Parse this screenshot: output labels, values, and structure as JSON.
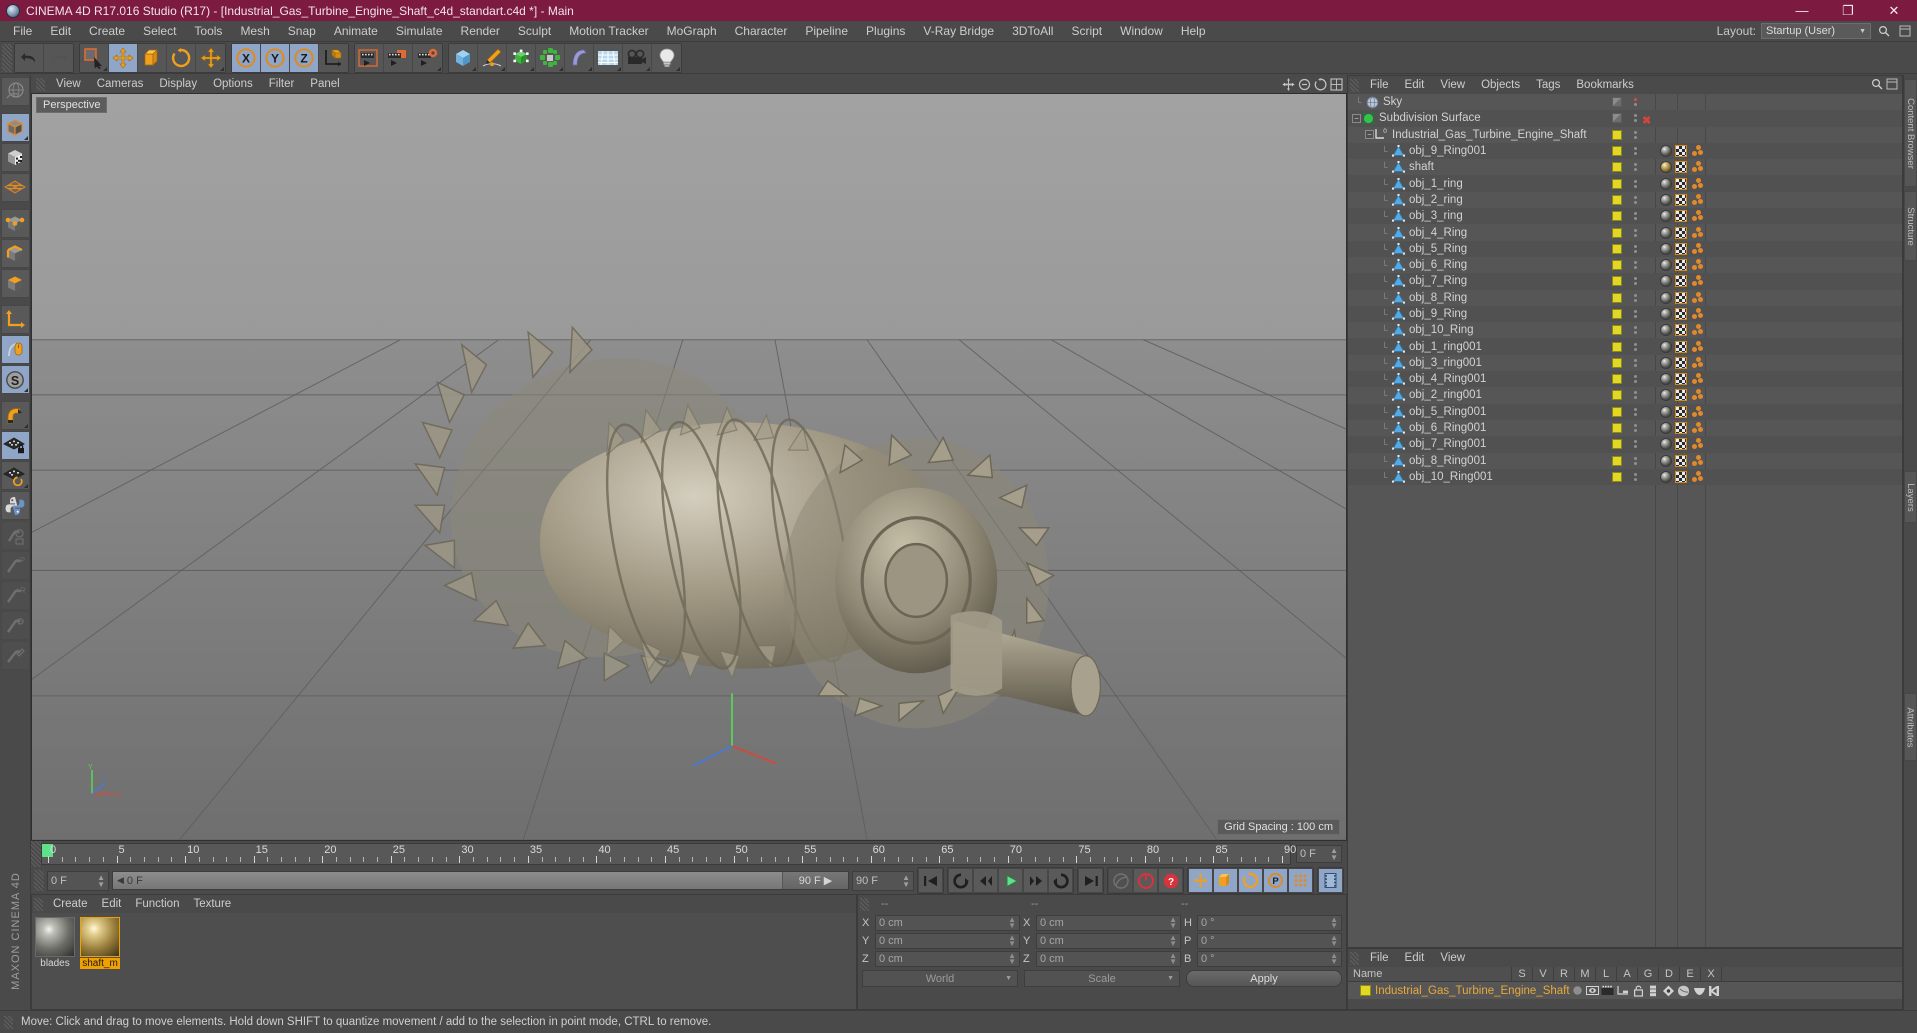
{
  "titlebar": {
    "title": "CINEMA 4D R17.016 Studio (R17) - [Industrial_Gas_Turbine_Engine_Shaft_c4d_standart.c4d *] - Main",
    "minimize": "—",
    "maximize": "❐",
    "close": "✕"
  },
  "menubar": {
    "items": [
      "File",
      "Edit",
      "Create",
      "Select",
      "Tools",
      "Mesh",
      "Snap",
      "Animate",
      "Simulate",
      "Render",
      "Sculpt",
      "Motion Tracker",
      "MoGraph",
      "Character",
      "Pipeline",
      "Plugins",
      "V-Ray Bridge",
      "3DToAll",
      "Script",
      "Window",
      "Help"
    ],
    "layout_label": "Layout:",
    "layout_value": "Startup (User)"
  },
  "viewport": {
    "menu": [
      "View",
      "Cameras",
      "Display",
      "Options",
      "Filter",
      "Panel"
    ],
    "persp_label": "Perspective",
    "grid_spacing": "Grid Spacing : 100 cm"
  },
  "timeline": {
    "ticks": [
      "0",
      "5",
      "10",
      "15",
      "20",
      "25",
      "30",
      "35",
      "40",
      "45",
      "50",
      "55",
      "60",
      "65",
      "70",
      "75",
      "80",
      "85",
      "90"
    ],
    "current_frame": "0 F",
    "start_frame": "0 F",
    "end_frame_track": "90 F",
    "end_frame": "90 F",
    "preview_end": "0 F"
  },
  "materials_panel": {
    "menu": [
      "Create",
      "Edit",
      "Function",
      "Texture"
    ],
    "items": [
      {
        "name": "blades",
        "selected": false,
        "kind": "grey"
      },
      {
        "name": "shaft_m",
        "selected": true,
        "kind": "gold"
      }
    ]
  },
  "coordinates": {
    "header_dashes": [
      "--",
      "--",
      "--"
    ],
    "rows": [
      {
        "pos_label": "X",
        "pos_value": "0 cm",
        "size_label": "X",
        "size_value": "0 cm",
        "rot_label": "H",
        "rot_value": "0 °"
      },
      {
        "pos_label": "Y",
        "pos_value": "0 cm",
        "size_label": "Y",
        "size_value": "0 cm",
        "rot_label": "P",
        "rot_value": "0 °"
      },
      {
        "pos_label": "Z",
        "pos_value": "0 cm",
        "size_label": "Z",
        "size_value": "0 cm",
        "rot_label": "B",
        "rot_value": "0 °"
      }
    ],
    "system": "World",
    "mode": "Scale",
    "apply": "Apply"
  },
  "object_manager": {
    "menu": [
      "File",
      "Edit",
      "View",
      "Objects",
      "Tags",
      "Bookmarks"
    ],
    "items": [
      {
        "label": "Sky",
        "depth": 1,
        "icon": "sky-icon",
        "expander": false,
        "swatch": "grey",
        "dots": "red",
        "tags": []
      },
      {
        "label": "Subdivision Surface",
        "depth": 1,
        "icon": "subdivision-icon",
        "expander": true,
        "swatch": "grey",
        "dots": "x",
        "tags": []
      },
      {
        "label": "Industrial_Gas_Turbine_Engine_Shaft",
        "depth": 2,
        "icon": "null-icon",
        "expander": true,
        "swatch": "yellow",
        "dots": "grey",
        "tags": [],
        "highlight": false
      },
      {
        "label": "obj_9_Ring001",
        "depth": 3,
        "icon": "polygon-icon",
        "swatch": "yellow",
        "dots": "grey",
        "tags": [
          "mat",
          "check",
          "sel"
        ]
      },
      {
        "label": "shaft",
        "depth": 3,
        "icon": "polygon-icon",
        "swatch": "yellow",
        "dots": "grey",
        "tags": [
          "mat-gold",
          "check",
          "sel"
        ]
      },
      {
        "label": "obj_1_ring",
        "depth": 3,
        "icon": "polygon-icon",
        "swatch": "yellow",
        "dots": "grey",
        "tags": [
          "mat",
          "check",
          "sel"
        ]
      },
      {
        "label": "obj_2_ring",
        "depth": 3,
        "icon": "polygon-icon",
        "swatch": "yellow",
        "dots": "grey",
        "tags": [
          "mat",
          "check",
          "sel"
        ]
      },
      {
        "label": "obj_3_ring",
        "depth": 3,
        "icon": "polygon-icon",
        "swatch": "yellow",
        "dots": "grey",
        "tags": [
          "mat",
          "check",
          "sel"
        ]
      },
      {
        "label": "obj_4_Ring",
        "depth": 3,
        "icon": "polygon-icon",
        "swatch": "yellow",
        "dots": "grey",
        "tags": [
          "mat",
          "check",
          "sel"
        ]
      },
      {
        "label": "obj_5_Ring",
        "depth": 3,
        "icon": "polygon-icon",
        "swatch": "yellow",
        "dots": "grey",
        "tags": [
          "mat",
          "check",
          "sel"
        ]
      },
      {
        "label": "obj_6_Ring",
        "depth": 3,
        "icon": "polygon-icon",
        "swatch": "yellow",
        "dots": "grey",
        "tags": [
          "mat",
          "check",
          "sel"
        ]
      },
      {
        "label": "obj_7_Ring",
        "depth": 3,
        "icon": "polygon-icon",
        "swatch": "yellow",
        "dots": "grey",
        "tags": [
          "mat",
          "check",
          "sel"
        ]
      },
      {
        "label": "obj_8_Ring",
        "depth": 3,
        "icon": "polygon-icon",
        "swatch": "yellow",
        "dots": "grey",
        "tags": [
          "mat",
          "check",
          "sel"
        ]
      },
      {
        "label": "obj_9_Ring",
        "depth": 3,
        "icon": "polygon-icon",
        "swatch": "yellow",
        "dots": "grey",
        "tags": [
          "mat",
          "check",
          "sel"
        ]
      },
      {
        "label": "obj_10_Ring",
        "depth": 3,
        "icon": "polygon-icon",
        "swatch": "yellow",
        "dots": "grey",
        "tags": [
          "mat",
          "check",
          "sel"
        ]
      },
      {
        "label": "obj_1_ring001",
        "depth": 3,
        "icon": "polygon-icon",
        "swatch": "yellow",
        "dots": "grey",
        "tags": [
          "mat",
          "check",
          "sel"
        ]
      },
      {
        "label": "obj_3_ring001",
        "depth": 3,
        "icon": "polygon-icon",
        "swatch": "yellow",
        "dots": "grey",
        "tags": [
          "mat",
          "check",
          "sel"
        ]
      },
      {
        "label": "obj_4_Ring001",
        "depth": 3,
        "icon": "polygon-icon",
        "swatch": "yellow",
        "dots": "grey",
        "tags": [
          "mat",
          "check",
          "sel"
        ]
      },
      {
        "label": "obj_2_ring001",
        "depth": 3,
        "icon": "polygon-icon",
        "swatch": "yellow",
        "dots": "grey",
        "tags": [
          "mat",
          "check",
          "sel"
        ]
      },
      {
        "label": "obj_5_Ring001",
        "depth": 3,
        "icon": "polygon-icon",
        "swatch": "yellow",
        "dots": "grey",
        "tags": [
          "mat",
          "check",
          "sel"
        ]
      },
      {
        "label": "obj_6_Ring001",
        "depth": 3,
        "icon": "polygon-icon",
        "swatch": "yellow",
        "dots": "grey",
        "tags": [
          "mat",
          "check",
          "sel"
        ]
      },
      {
        "label": "obj_7_Ring001",
        "depth": 3,
        "icon": "polygon-icon",
        "swatch": "yellow",
        "dots": "grey",
        "tags": [
          "mat",
          "check",
          "sel"
        ]
      },
      {
        "label": "obj_8_Ring001",
        "depth": 3,
        "icon": "polygon-icon",
        "swatch": "yellow",
        "dots": "grey",
        "tags": [
          "mat",
          "check",
          "sel"
        ]
      },
      {
        "label": "obj_10_Ring001",
        "depth": 3,
        "icon": "polygon-icon",
        "swatch": "yellow",
        "dots": "grey",
        "tags": [
          "mat",
          "check",
          "sel"
        ]
      }
    ]
  },
  "material_manager": {
    "menu": [
      "File",
      "Edit",
      "View"
    ],
    "columns": [
      "Name",
      "S",
      "V",
      "R",
      "M",
      "L",
      "A",
      "G",
      "D",
      "E",
      "X"
    ],
    "rows": [
      {
        "name": "Industrial_Gas_Turbine_Engine_Shaft"
      }
    ]
  },
  "right_tabs": [
    "Content Browser",
    "Structure",
    "Layers",
    "Attributes"
  ],
  "statusbar": {
    "message": "Move: Click and drag to move elements. Hold down SHIFT to quantize movement / add to the selection in point mode, CTRL to remove."
  },
  "brand": "MAXON CINEMA 4D",
  "colors": {
    "title_bar": "#7c1a3f",
    "panel_bg": "#4a4a4a",
    "list_bg": "#565656",
    "accent_orange": "#e8a83c",
    "swatch_yellow": "#e2d723",
    "active_blue": "#8fa6c8",
    "play_green": "#5fe08a"
  }
}
